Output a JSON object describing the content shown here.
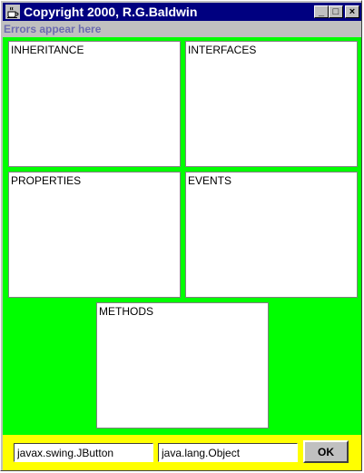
{
  "window": {
    "title": "Copyright 2000, R.G.Baldwin",
    "controls": {
      "minimize": "_",
      "maximize": "□",
      "close": "×"
    },
    "icon": "java-coffee-cup-icon"
  },
  "error_bar": {
    "text": "Errors appear here"
  },
  "panels": {
    "inheritance": "INHERITANCE",
    "interfaces": "INTERFACES",
    "properties": "PROPERTIES",
    "events": "EVENTS",
    "methods": "METHODS"
  },
  "inputs": {
    "class_name": "javax.swing.JButton",
    "stop_class": "java.lang.Object"
  },
  "buttons": {
    "ok": "OK"
  },
  "colors": {
    "title_bar": "#000080",
    "content_background": "#00ff00",
    "bottom_bar": "#ffff00",
    "error_text": "#6c6cb0"
  }
}
